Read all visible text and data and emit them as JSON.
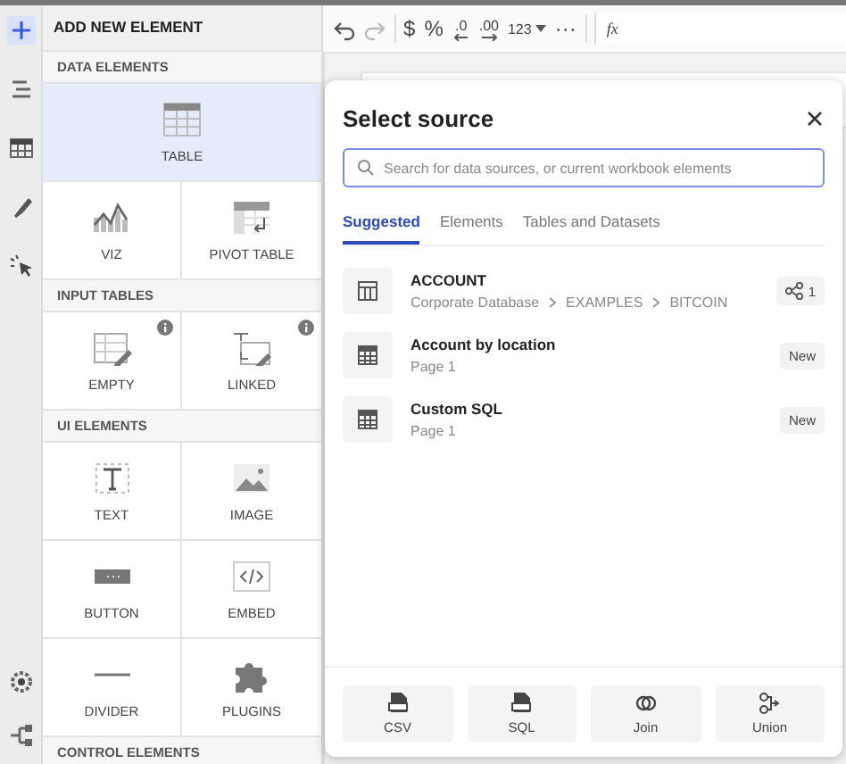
{
  "tool_rail": {
    "top": [
      {
        "kind": "add",
        "selected": true
      },
      {
        "kind": "list",
        "selected": false
      },
      {
        "kind": "table",
        "selected": false
      },
      {
        "kind": "brush",
        "selected": false
      },
      {
        "kind": "pointer",
        "selected": false
      }
    ],
    "bottom": [
      {
        "kind": "settings",
        "selected": false
      },
      {
        "kind": "lineage",
        "selected": false
      }
    ]
  },
  "panel": {
    "title": "ADD NEW ELEMENT",
    "sections": [
      {
        "title": "DATA ELEMENTS",
        "tiles": [
          {
            "kind": "table",
            "label": "TABLE",
            "selected": true,
            "info": false
          },
          {
            "kind": "viz",
            "label": "VIZ",
            "selected": false,
            "info": false
          },
          {
            "kind": "pivot",
            "label": "PIVOT TABLE",
            "selected": false,
            "info": false
          }
        ]
      },
      {
        "title": "INPUT TABLES",
        "tiles": [
          {
            "kind": "empty",
            "label": "EMPTY",
            "selected": false,
            "info": true
          },
          {
            "kind": "linked",
            "label": "LINKED",
            "selected": false,
            "info": true
          }
        ]
      },
      {
        "title": "UI ELEMENTS",
        "tiles": [
          {
            "kind": "text",
            "label": "TEXT",
            "selected": false,
            "info": false
          },
          {
            "kind": "image",
            "label": "IMAGE",
            "selected": false,
            "info": false
          },
          {
            "kind": "button",
            "label": "BUTTON",
            "selected": false,
            "info": false
          },
          {
            "kind": "embed",
            "label": "EMBED",
            "selected": false,
            "info": false
          },
          {
            "kind": "divider",
            "label": "DIVIDER",
            "selected": false,
            "info": false
          },
          {
            "kind": "plugins",
            "label": "PLUGINS",
            "selected": false,
            "info": false
          }
        ]
      },
      {
        "title": "CONTROL ELEMENTS"
      }
    ]
  },
  "toolbar": {
    "groups": [
      [
        {
          "kind": "undo",
          "disabled": false
        },
        {
          "kind": "redo",
          "disabled": true
        }
      ],
      [
        {
          "kind": "text",
          "label": "$"
        },
        {
          "kind": "text",
          "label": "%"
        },
        {
          "kind": "decimal-less",
          "label": ".0"
        },
        {
          "kind": "decimal-more",
          "label": ".00"
        },
        {
          "kind": "dropdown",
          "label": "123"
        },
        {
          "kind": "text",
          "label": "···"
        }
      ]
    ],
    "formula": {
      "label": "fx"
    }
  },
  "dialog": {
    "title": "Select source",
    "search": {
      "placeholder": "Search for data sources, or current workbook elements"
    },
    "tabs": [
      {
        "label": "Suggested",
        "selected": true
      },
      {
        "label": "Elements",
        "selected": false
      },
      {
        "label": "Tables and Datasets",
        "selected": false
      }
    ],
    "sources": [
      {
        "kind": "table",
        "name": "ACCOUNT",
        "path": [
          "Corporate Database",
          "EXAMPLES",
          "BITCOIN"
        ],
        "badge": {
          "kind": "lineage",
          "text": "1"
        }
      },
      {
        "kind": "element",
        "name": "Account by location",
        "subtitle": "Page 1",
        "badge": {
          "kind": "new",
          "text": "New"
        }
      },
      {
        "kind": "element",
        "name": "Custom SQL",
        "subtitle": "Page 1",
        "badge": {
          "kind": "new",
          "text": "New"
        }
      }
    ],
    "actions": [
      {
        "kind": "csv",
        "label": "CSV"
      },
      {
        "kind": "sql",
        "label": "SQL"
      },
      {
        "kind": "join",
        "label": "Join"
      },
      {
        "kind": "union",
        "label": "Union"
      }
    ]
  }
}
